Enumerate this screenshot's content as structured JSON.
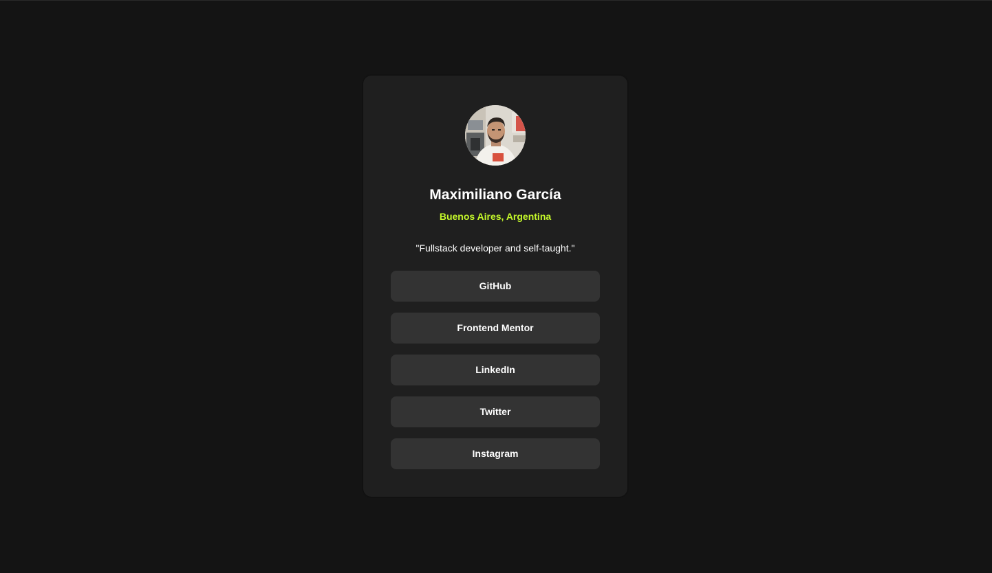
{
  "profile": {
    "name": "Maximiliano García",
    "location": "Buenos Aires, Argentina",
    "bio": "\"Fullstack developer and self-taught.\""
  },
  "links": [
    {
      "label": "GitHub"
    },
    {
      "label": "Frontend Mentor"
    },
    {
      "label": "LinkedIn"
    },
    {
      "label": "Twitter"
    },
    {
      "label": "Instagram"
    }
  ],
  "colors": {
    "background": "#141414",
    "card": "#1f1f1f",
    "button": "#333333",
    "accent": "#c4f82a",
    "text": "#ffffff"
  }
}
